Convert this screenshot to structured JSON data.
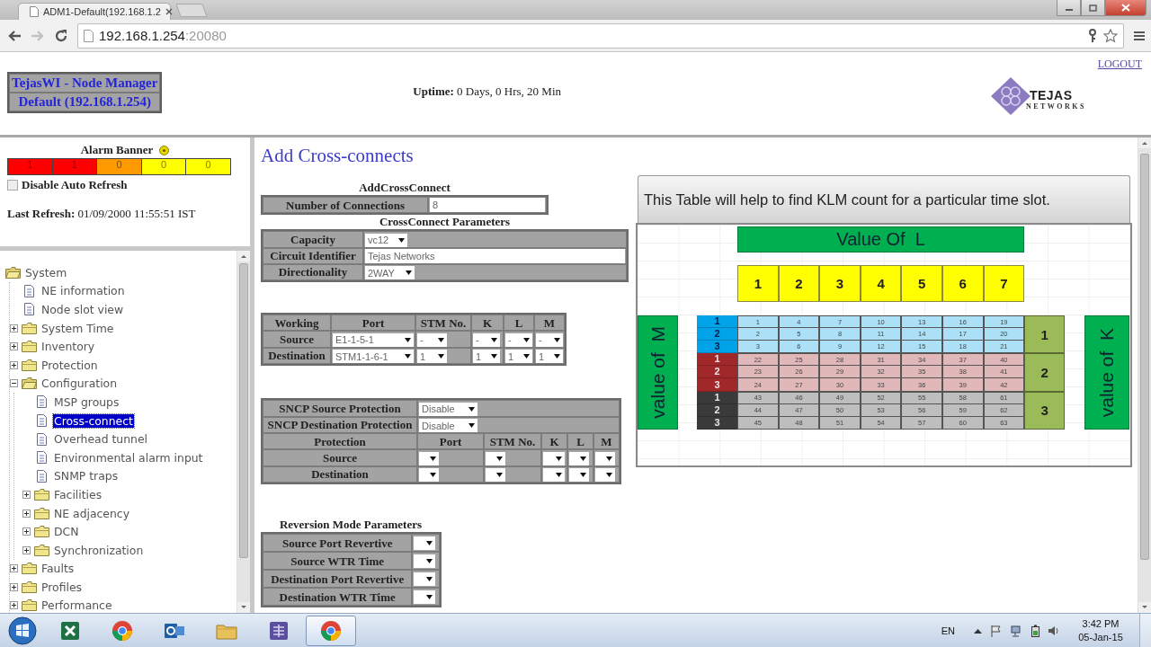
{
  "browser": {
    "tab_title": "ADM1-Default(192.168.1.2",
    "address_host": "192.168.1.254",
    "address_port": ":20080"
  },
  "header": {
    "title": "TejasWI - Node Manager",
    "node": "Default (192.168.1.254)",
    "uptime": "**Uptime:** 0 Days, 0 Hrs, 20 Min",
    "logout": "LOGOUT",
    "logo_name": "TEJAS",
    "logo_tagline": "NETWORKS"
  },
  "alarm_banner": {
    "title": "Alarm Banner",
    "counts": [
      {
        "value": "1",
        "color": "#ff0000"
      },
      {
        "value": "1",
        "color": "#ff0000"
      },
      {
        "value": "0",
        "color": "#ff9900"
      },
      {
        "value": "0",
        "color": "#ffff00"
      },
      {
        "value": "0",
        "color": "#ffff00"
      }
    ],
    "disable_auto_refresh": {
      "label": "Disable Auto Refresh",
      "checked": false
    },
    "last_refresh": "**Last Refresh:** 01/09/2000 11:55:51 IST"
  },
  "nav_tree": [
    {
      "label": "System",
      "kind": "folder",
      "expanded": true,
      "selected": false,
      "children": [
        {
          "label": "NE information",
          "kind": "page",
          "selected": false
        },
        {
          "label": "Node slot view",
          "kind": "page",
          "selected": false
        },
        {
          "label": "System Time",
          "kind": "folder",
          "expanded": false,
          "selected": false
        },
        {
          "label": "Inventory",
          "kind": "folder",
          "expanded": false,
          "selected": false
        },
        {
          "label": "Protection",
          "kind": "folder",
          "expanded": false,
          "selected": false
        },
        {
          "label": "Configuration",
          "kind": "folder",
          "expanded": true,
          "selected": false,
          "children": [
            {
              "label": "MSP groups",
              "kind": "page",
              "selected": false
            },
            {
              "label": "Cross-connect",
              "kind": "page",
              "selected": true
            },
            {
              "label": "Overhead tunnel",
              "kind": "page",
              "selected": false
            },
            {
              "label": "Environmental alarm input",
              "kind": "page",
              "selected": false
            },
            {
              "label": "SNMP traps",
              "kind": "page",
              "selected": false
            },
            {
              "label": "Facilities",
              "kind": "folder",
              "expanded": false,
              "selected": false
            },
            {
              "label": "NE adjacency",
              "kind": "folder",
              "expanded": false,
              "selected": false
            },
            {
              "label": "DCN",
              "kind": "folder",
              "expanded": false,
              "selected": false
            },
            {
              "label": "Synchronization",
              "kind": "folder",
              "expanded": false,
              "selected": false
            }
          ]
        },
        {
          "label": "Faults",
          "kind": "folder",
          "expanded": false,
          "selected": false
        },
        {
          "label": "Profiles",
          "kind": "folder",
          "expanded": false,
          "selected": false
        },
        {
          "label": "Performance",
          "kind": "folder",
          "expanded": false,
          "selected": false
        }
      ]
    }
  ],
  "form": {
    "title": "Add Cross-connects",
    "add_heading": "AddCrossConnect",
    "number_label": "Number of Connections",
    "number_value": "8",
    "params_heading": "CrossConnect Parameters",
    "params": [
      {
        "label": "Capacity",
        "kind": "select",
        "value": "vc12"
      },
      {
        "label": "Circuit Identifier",
        "kind": "text",
        "value": "Tejas Networks"
      },
      {
        "label": "Directionality",
        "kind": "select",
        "value": "2WAY"
      }
    ],
    "working_columns": [
      "Working",
      "Port",
      "STM No.",
      "K",
      "L",
      "M"
    ],
    "working_rows": [
      {
        "label": "Source",
        "values": [
          "E1-1-5-1",
          "-",
          "-",
          "-",
          "-"
        ]
      },
      {
        "label": "Destination",
        "values": [
          "STM1-1-6-1",
          "1",
          "1",
          "1",
          "1"
        ]
      }
    ],
    "sncp": [
      {
        "label": "SNCP Source Protection",
        "value": "Disable"
      },
      {
        "label": "SNCP Destination Protection",
        "value": "Disable"
      }
    ],
    "protection_columns": [
      "Protection",
      "Port",
      "STM No.",
      "K",
      "L",
      "M"
    ],
    "protection_rows": [
      "Source",
      "Destination"
    ],
    "reversion_heading": "Reversion Mode Parameters",
    "reversion_rows": [
      "Source Port Revertive",
      "Source WTR Time",
      "Destination Port Revertive",
      "Destination WTR Time"
    ]
  },
  "klm_guide": {
    "caption": "This Table will help to find KLM count for a particular time slot.",
    "l_title": "Value Of  L",
    "l_values": [
      "1",
      "2",
      "3",
      "4",
      "5",
      "6",
      "7"
    ],
    "m_title": "value of  M",
    "k_title": "value of  K",
    "k_groups": [
      {
        "k": "1",
        "color": "#00a2e8",
        "rows": [
          {
            "m": "1",
            "values": [
              "1",
              "4",
              "7",
              "10",
              "13",
              "16",
              "19"
            ]
          },
          {
            "m": "2",
            "values": [
              "2",
              "5",
              "8",
              "11",
              "14",
              "17",
              "20"
            ]
          },
          {
            "m": "3",
            "values": [
              "3",
              "6",
              "9",
              "12",
              "15",
              "18",
              "21"
            ]
          }
        ]
      },
      {
        "k": "2",
        "color": "#a0282a",
        "rows": [
          {
            "m": "1",
            "values": [
              "22",
              "25",
              "28",
              "31",
              "34",
              "37",
              "40"
            ]
          },
          {
            "m": "2",
            "values": [
              "23",
              "26",
              "29",
              "32",
              "35",
              "38",
              "41"
            ]
          },
          {
            "m": "3",
            "values": [
              "24",
              "27",
              "30",
              "33",
              "36",
              "39",
              "42"
            ]
          }
        ]
      },
      {
        "k": "3",
        "color": "#3a3a3a",
        "rows": [
          {
            "m": "1",
            "values": [
              "43",
              "46",
              "49",
              "52",
              "55",
              "58",
              "61"
            ]
          },
          {
            "m": "2",
            "values": [
              "44",
              "47",
              "50",
              "53",
              "56",
              "59",
              "62"
            ]
          },
          {
            "m": "3",
            "values": [
              "45",
              "48",
              "51",
              "54",
              "57",
              "60",
              "63"
            ]
          }
        ]
      }
    ]
  },
  "taskbar": {
    "apps": [
      {
        "active": false
      },
      {
        "active": false
      },
      {
        "active": false
      },
      {
        "active": false
      },
      {
        "active": false
      },
      {
        "active": true
      }
    ],
    "language": "EN",
    "time": "3:42 PM",
    "date": "05-Jan-15"
  }
}
